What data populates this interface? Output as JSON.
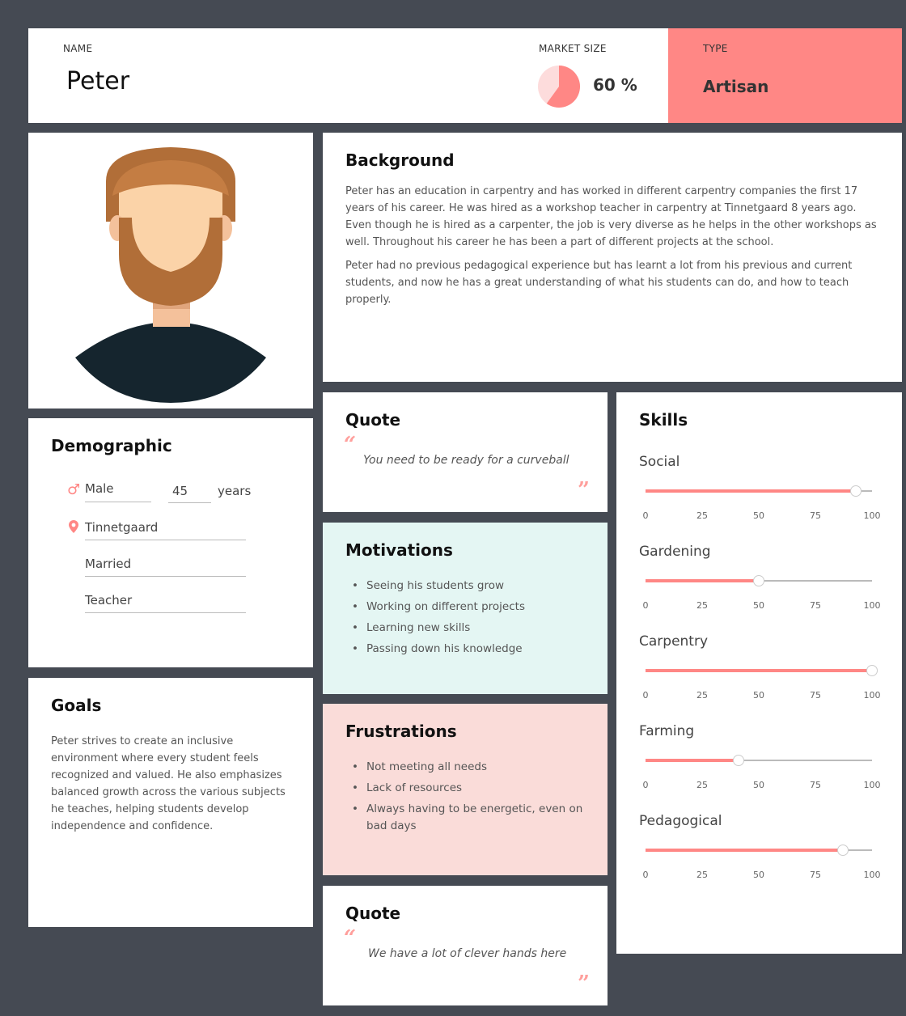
{
  "header": {
    "name_label": "NAME",
    "name_value": "Peter",
    "market_label": "MARKET SIZE",
    "market_value": "60 %",
    "market_fraction": 0.6,
    "type_label": "TYPE",
    "type_value": "Artisan"
  },
  "background": {
    "title": "Background",
    "paragraphs": [
      "Peter has an education in carpentry and has worked in different carpentry companies the first 17 years of his career. He was hired as a workshop teacher in carpentry at Tinnetgaard 8 years ago. Even though he is hired as a carpenter, the job is very diverse as he helps in the other workshops as well. Throughout his career he has been a part of different projects at the school.",
      "Peter had no previous pedagogical experience but has learnt a lot from his previous and current students, and now he has a great understanding of what his students can do, and how to teach properly."
    ]
  },
  "demographic": {
    "title": "Demographic",
    "gender": "Male",
    "age": "45",
    "age_unit": "years",
    "location": "Tinnetgaard",
    "status": "Married",
    "occupation": "Teacher"
  },
  "goals": {
    "title": "Goals",
    "text": "Peter strives to create an inclusive environment where every student feels recognized and valued. He also emphasizes balanced growth across the various subjects he teaches, helping students develop independence and confidence."
  },
  "quote1": {
    "title": "Quote",
    "text": "You need to be ready for a curveball"
  },
  "quote2": {
    "title": "Quote",
    "text": "We have a lot of clever hands here"
  },
  "motivations": {
    "title": "Motivations",
    "items": [
      "Seeing his students grow",
      "Working on different projects",
      "Learning new skills",
      "Passing down his knowledge"
    ]
  },
  "frustrations": {
    "title": "Frustrations",
    "items": [
      "Not meeting all needs",
      "Lack of resources",
      "Always having to be energetic, even on bad days"
    ]
  },
  "skills": {
    "title": "Skills",
    "ticks": [
      "0",
      "25",
      "50",
      "75",
      "100"
    ],
    "items": [
      {
        "name": "Social",
        "value": 93
      },
      {
        "name": "Gardening",
        "value": 50
      },
      {
        "name": "Carpentry",
        "value": 100
      },
      {
        "name": "Farming",
        "value": 41
      },
      {
        "name": "Pedagogical",
        "value": 87
      }
    ]
  },
  "colors": {
    "accent": "#ff8785",
    "background": "#454a53",
    "motivations_bg": "#e4f6f3",
    "frustrations_bg": "#fadcd9",
    "pie_light": "#fddcdc"
  },
  "icons": {
    "gender": "male-symbol-icon",
    "location": "location-pin-icon",
    "quote": "quote-mark-icon"
  }
}
